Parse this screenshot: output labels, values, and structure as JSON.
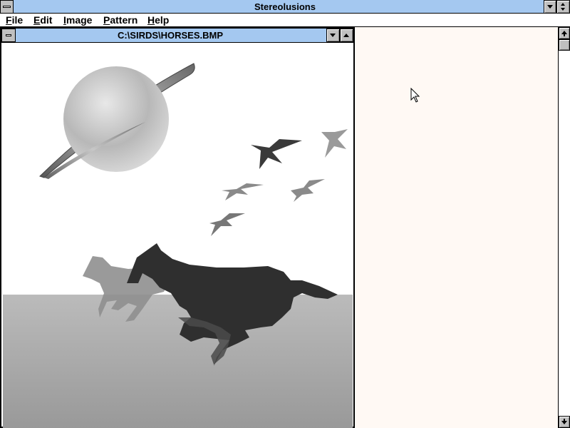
{
  "app": {
    "title": "Stereolusions"
  },
  "menu": {
    "items": [
      "File",
      "Edit",
      "Image",
      "Pattern",
      "Help"
    ],
    "access_keys": [
      "F",
      "E",
      "I",
      "P",
      "H"
    ]
  },
  "document": {
    "title": "C:\\SIRDS\\HORSES.BMP"
  },
  "icons": {
    "system_menu": "system-menu-icon",
    "scroll_down": "arrow-down-icon",
    "scroll_up": "arrow-up-icon",
    "cursor": "mouse-pointer-icon"
  },
  "colors": {
    "titlebar": "#a4c8f0",
    "canvas_right": "#fff9f4",
    "ground": "#b3b3b3"
  }
}
